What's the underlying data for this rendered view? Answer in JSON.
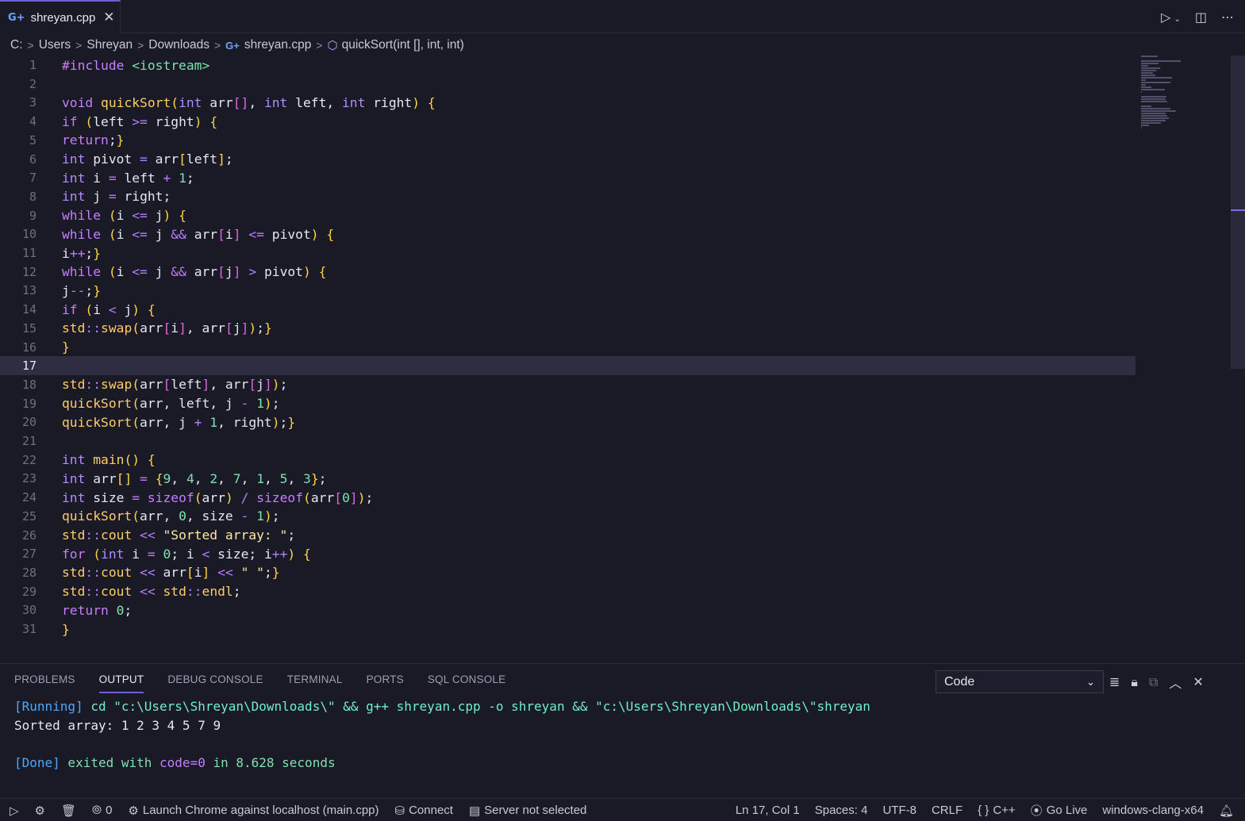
{
  "tab": {
    "filename": "shreyan.cpp",
    "close_glyph": "✕"
  },
  "breadcrumb": {
    "parts": [
      "C:",
      "Users",
      "Shreyan",
      "Downloads"
    ],
    "file": "shreyan.cpp",
    "symbol": "quickSort(int [], int, int)"
  },
  "editor": {
    "current_line": 17,
    "line_numbers": [
      "1",
      "2",
      "3",
      "4",
      "5",
      "6",
      "7",
      "8",
      "9",
      "10",
      "11",
      "12",
      "13",
      "14",
      "15",
      "16",
      "17",
      "18",
      "19",
      "20",
      "21",
      "22",
      "23",
      "24",
      "25",
      "26",
      "27",
      "28",
      "29",
      "30",
      "31"
    ],
    "lines": [
      "#include <iostream>",
      "",
      "void quickSort(int arr[], int left, int right) {",
      "if (left >= right) {",
      "return;}",
      "int pivot = arr[left];",
      "int i = left + 1;",
      "int j = right;",
      "while (i <= j) {",
      "while (i <= j && arr[i] <= pivot) {",
      "i++;}",
      "while (i <= j && arr[j] > pivot) {",
      "j--;}",
      "if (i < j) {",
      "std::swap(arr[i], arr[j]);}",
      "}",
      "",
      "std::swap(arr[left], arr[j]);",
      "quickSort(arr, left, j - 1);",
      "quickSort(arr, j + 1, right);}",
      "",
      "int main() {",
      "int arr[] = {9, 4, 2, 7, 1, 5, 3};",
      "int size = sizeof(arr) / sizeof(arr[0]);",
      "quickSort(arr, 0, size - 1);",
      "std::cout << \"Sorted array: \";",
      "for (int i = 0; i < size; i++) {",
      "std::cout << arr[i] << \" \";}",
      "std::cout << std::endl;",
      "return 0;",
      "}"
    ]
  },
  "panel": {
    "tabs": [
      "PROBLEMS",
      "OUTPUT",
      "DEBUG CONSOLE",
      "TERMINAL",
      "PORTS",
      "SQL CONSOLE"
    ],
    "active_tab": "OUTPUT",
    "output_channel": "Code",
    "output": {
      "running_tag": "[Running]",
      "command": " cd \"c:\\Users\\Shreyan\\Downloads\\\" && g++ shreyan.cpp -o shreyan && \"c:\\Users\\Shreyan\\Downloads\\\"shreyan",
      "result": "Sorted array: 1 2 3 4 5 7 9",
      "done_tag": "[Done]",
      "done_pre": " exited with ",
      "done_code": "code=0",
      "done_post": " in 8.628 seconds"
    }
  },
  "statusbar": {
    "ports": "0",
    "launch": "Launch Chrome against localhost (main.cpp)",
    "connect": "Connect",
    "server": "Server not selected",
    "position": "Ln 17, Col 1",
    "spaces": "Spaces: 4",
    "encoding": "UTF-8",
    "eol": "CRLF",
    "language": "C++",
    "golive": "Go Live",
    "compiler": "windows-clang-x64"
  },
  "colors": {
    "accent": "#6b5fd6",
    "background": "#1a1926",
    "current_line": "#2f2d42"
  },
  "icons": [
    "cpp-file-icon",
    "close-icon",
    "run-icon",
    "split-editor-icon",
    "more-icon",
    "symbol-method-icon",
    "clear-output-icon",
    "lock-icon",
    "copy-icon",
    "maximize-panel-icon",
    "close-panel-icon",
    "run-debug-icon",
    "debug-icon",
    "trash-icon",
    "ports-icon",
    "launch-icon",
    "database-icon",
    "server-icon",
    "braces-icon",
    "broadcast-icon",
    "bell-icon"
  ]
}
